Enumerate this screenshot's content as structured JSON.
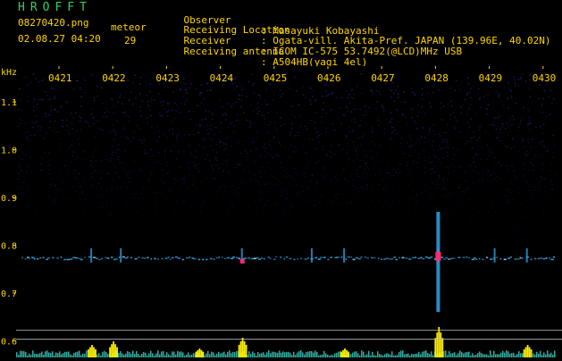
{
  "header": {
    "logo": "HROFFT",
    "filename": "08270420.png",
    "datetime": "02.08.27 04:20",
    "meteor_label": "meteor",
    "meteor_count": "29",
    "fields": [
      {
        "label": "Observer",
        "value": ": Masayuki Kobayashi"
      },
      {
        "label": "Receiving Location",
        "value": ": Ogata-vill. Akita-Pref. JAPAN (139.96E, 40.02N)"
      },
      {
        "label": "Receiver",
        "value": ": ICOM IC-575 53.7492(@LCD)MHz USB"
      },
      {
        "label": "Receiving antenna",
        "value": ": A504HB(yagi 4el)"
      }
    ]
  },
  "spectrogram": {
    "unit_label": "kHz",
    "time_ticks": [
      "0421",
      "0422",
      "0423",
      "0424",
      "0425",
      "0426",
      "0427",
      "0428",
      "0429",
      "0430"
    ],
    "freq_ticks": [
      "1.1",
      "1.0",
      "0.9",
      "0.8",
      "0.7",
      "0.6"
    ],
    "freq_ticks_values": [
      1.1,
      1.0,
      0.9,
      0.8,
      0.7,
      0.6
    ],
    "freq_range": [
      0.58,
      1.16
    ],
    "colors": {
      "background": "#000000",
      "noise": "#2a2aa8",
      "carrier": "#2e9bd8",
      "burst": "#ff2a7a",
      "level_bar": "#ffee00",
      "level_low": "#3cd7c8",
      "tick_text": "#ffd400"
    },
    "meteor_minutes": [
      0.6,
      1.15,
      3.4,
      4.7,
      5.3,
      7.05,
      8.1,
      8.7
    ]
  }
}
